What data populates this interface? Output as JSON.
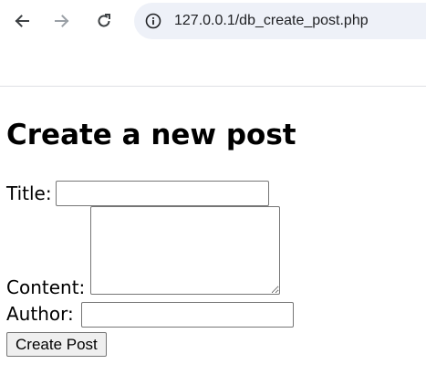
{
  "browser": {
    "url": "127.0.0.1/db_create_post.php",
    "back_icon": "arrow-left-icon",
    "forward_icon": "arrow-right-icon",
    "reload_icon": "reload-icon",
    "site_info_icon": "info-circle-icon"
  },
  "page": {
    "heading": "Create a new post",
    "form": {
      "title_label": "Title:",
      "title_value": "",
      "content_label": "Content:",
      "content_value": "",
      "author_label": "Author:",
      "author_value": "",
      "submit_label": "Create Post"
    }
  },
  "colors": {
    "omnibox_bg": "#eef1f8",
    "disabled_icon": "#9aa0a6",
    "icon": "#5f6368"
  }
}
